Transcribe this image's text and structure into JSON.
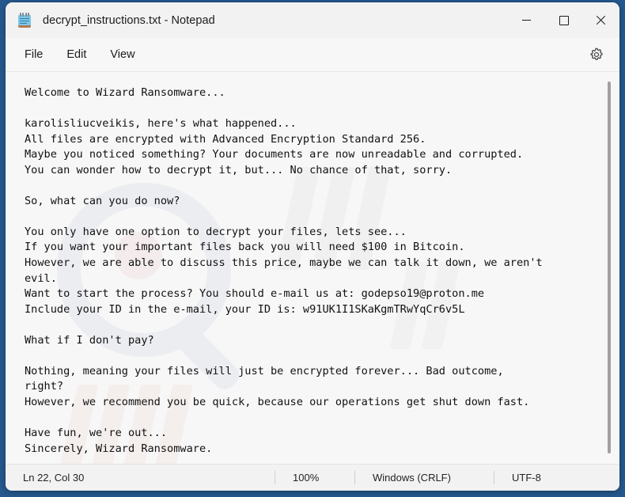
{
  "window": {
    "title": "decrypt_instructions.txt - Notepad",
    "app_icon": "notepad-icon",
    "desktop_background_color": "#25598f",
    "controls": {
      "minimize": "minimize-icon",
      "maximize": "maximize-icon",
      "close": "close-icon"
    }
  },
  "menubar": {
    "items": [
      {
        "label": "File"
      },
      {
        "label": "Edit"
      },
      {
        "label": "View"
      }
    ],
    "settings_icon": "gear-icon"
  },
  "document": {
    "filename": "decrypt_instructions.txt",
    "body": "Welcome to Wizard Ransomware...\n\nkarolisliucveikis, here's what happened...\nAll files are encrypted with Advanced Encryption Standard 256.\nMaybe you noticed something? Your documents are now unreadable and corrupted.\nYou can wonder how to decrypt it, but... No chance of that, sorry.\n\nSo, what can you do now?\n\nYou only have one option to decrypt your files, lets see...\nIf you want your important files back you will need $100 in Bitcoin.\nHowever, we are able to discuss this price, maybe we can talk it down, we aren't\nevil.\nWant to start the process? You should e-mail us at: godepso19@proton.me\nInclude your ID in the e-mail, your ID is: w91UK1I1SKaKgmTRwYqCr6v5L\n\nWhat if I don't pay?\n\nNothing, meaning your files will just be encrypted forever... Bad outcome,\nright?\nHowever, we recommend you be quick, because our operations get shut down fast.\n\nHave fun, we're out...\nSincerely, Wizard Ransomware.",
    "ransom_amount": "$100",
    "currency": "Bitcoin",
    "contact_email": "godepso19@proton.me",
    "victim_id": "w91UK1I1SKaKgmTRwYqCr6v5L",
    "victim_name": "karolisliucveikis",
    "encryption": "Advanced Encryption Standard 256",
    "signature": "Wizard Ransomware"
  },
  "statusbar": {
    "cursor_position": "Ln 22, Col 30",
    "zoom": "100%",
    "line_ending": "Windows (CRLF)",
    "encoding": "UTF-8"
  }
}
